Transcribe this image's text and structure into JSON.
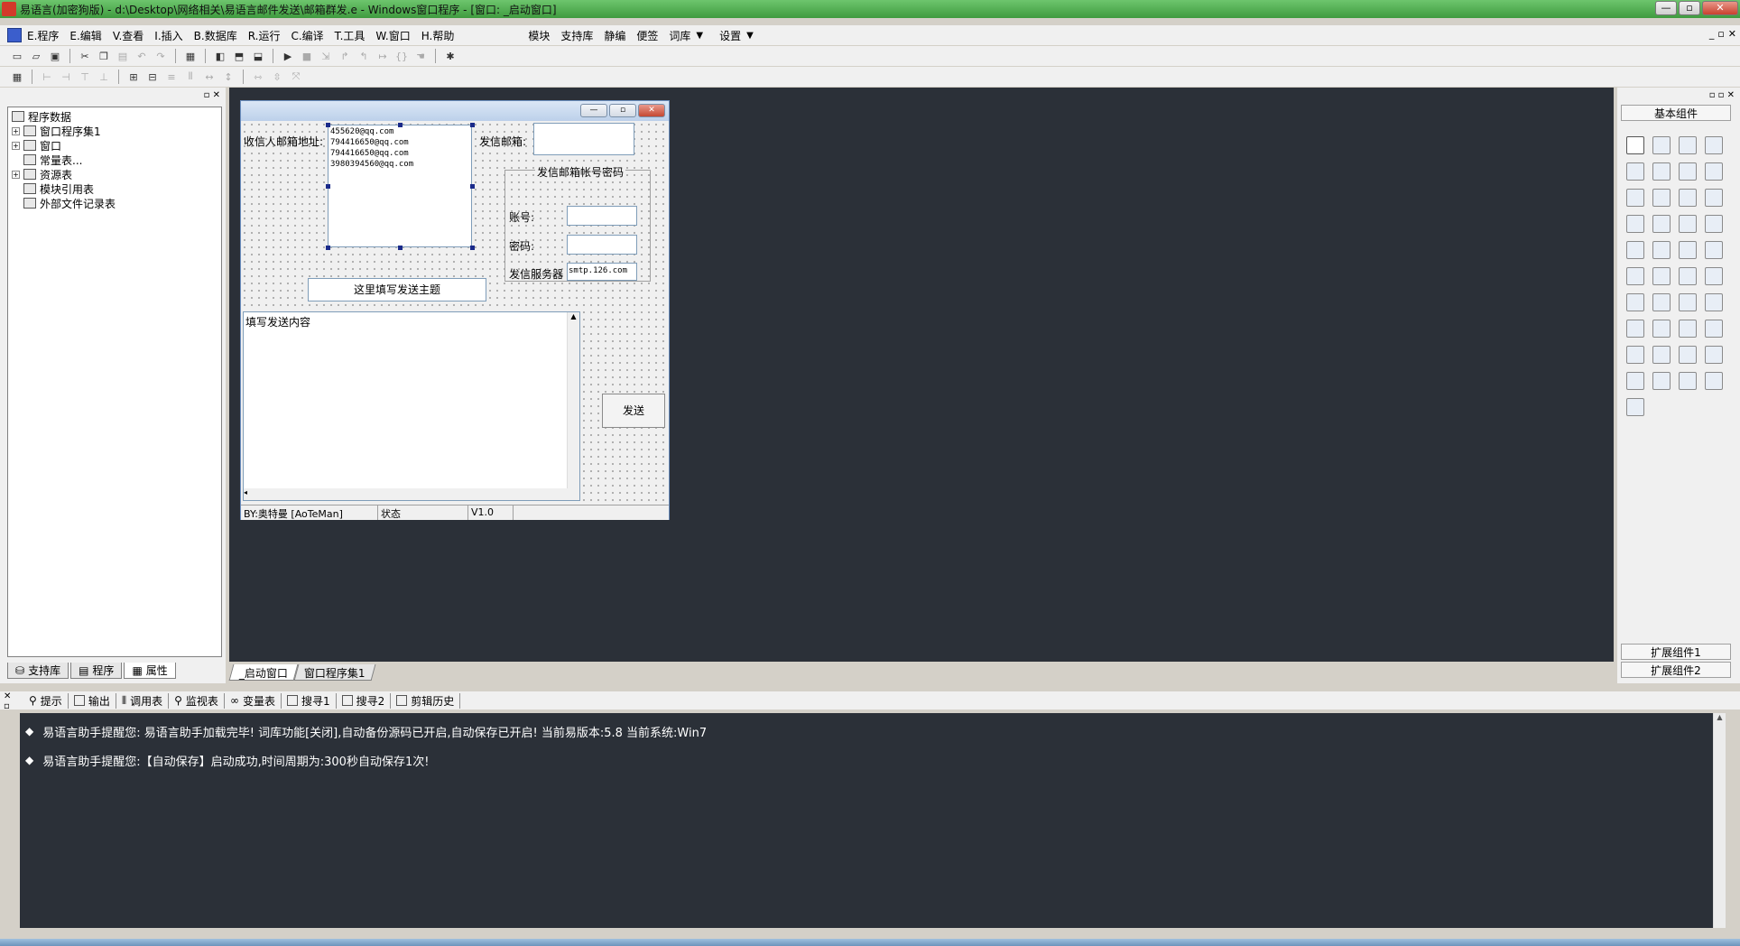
{
  "window": {
    "title": "易语言(加密狗版) - d:\\Desktop\\网络相关\\易语言邮件发送\\邮箱群发.e - Windows窗口程序 - [窗口: _启动窗口]",
    "controls": [
      "—",
      "▫",
      "✕"
    ]
  },
  "menu": {
    "items": [
      "E.程序",
      "E.编辑",
      "V.查看",
      "I.插入",
      "B.数据库",
      "R.运行",
      "C.编译",
      "T.工具",
      "W.窗口",
      "H.帮助"
    ],
    "extra": [
      "模块",
      "支持库",
      "静编",
      "便签",
      "词库",
      "设置"
    ],
    "mdi_controls": [
      "_",
      "▫",
      "✕"
    ]
  },
  "left_panel": {
    "tree": [
      {
        "label": "程序数据",
        "level": 0,
        "expander": ""
      },
      {
        "label": "窗口程序集1",
        "level": 1,
        "expander": "+"
      },
      {
        "label": "窗口",
        "level": 1,
        "expander": "+"
      },
      {
        "label": "常量表...",
        "level": 1,
        "expander": ""
      },
      {
        "label": "资源表",
        "level": 1,
        "expander": "+"
      },
      {
        "label": "模块引用表",
        "level": 1,
        "expander": ""
      },
      {
        "label": "外部文件记录表",
        "level": 1,
        "expander": ""
      }
    ],
    "tabs": [
      "支持库",
      "程序",
      "属性"
    ]
  },
  "design_window": {
    "recipient_label": "收信人邮箱地址:",
    "recipients": [
      "455620@qq.com",
      "794416650@qq.com",
      "794416650@qq.com",
      "3980394560@qq.com"
    ],
    "sender_label": "发信邮箱:",
    "group_title": "发信邮箱帐号密码",
    "account_label": "账号:",
    "password_label": "密码:",
    "server_label": "发信服务器",
    "server_value": "smtp.126.com",
    "subject_placeholder": "这里填写发送主题",
    "content_placeholder": "填写发送内容",
    "send_button": "发送",
    "status": [
      "BY:奥特曼 [AoTeMan]",
      "状态",
      "V1.0"
    ]
  },
  "palette": {
    "header": "基本组件",
    "footer1": "扩展组件1",
    "footer2": "扩展组件2"
  },
  "doc_tabs": [
    "_启动窗口",
    "窗口程序集1"
  ],
  "output": {
    "tabs": [
      "提示",
      "输出",
      "调用表",
      "监视表",
      "变量表",
      "搜寻1",
      "搜寻2",
      "剪辑历史"
    ],
    "lines": [
      "易语言助手提醒您:  易语言助手加载完毕!  词库功能[关闭],自动备份源码已开启,自动保存已开启!  当前易版本:5.8  当前系统:Win7",
      "易语言助手提醒您:【自动保存】启动成功,时间周期为:300秒自动保存1次!"
    ]
  }
}
